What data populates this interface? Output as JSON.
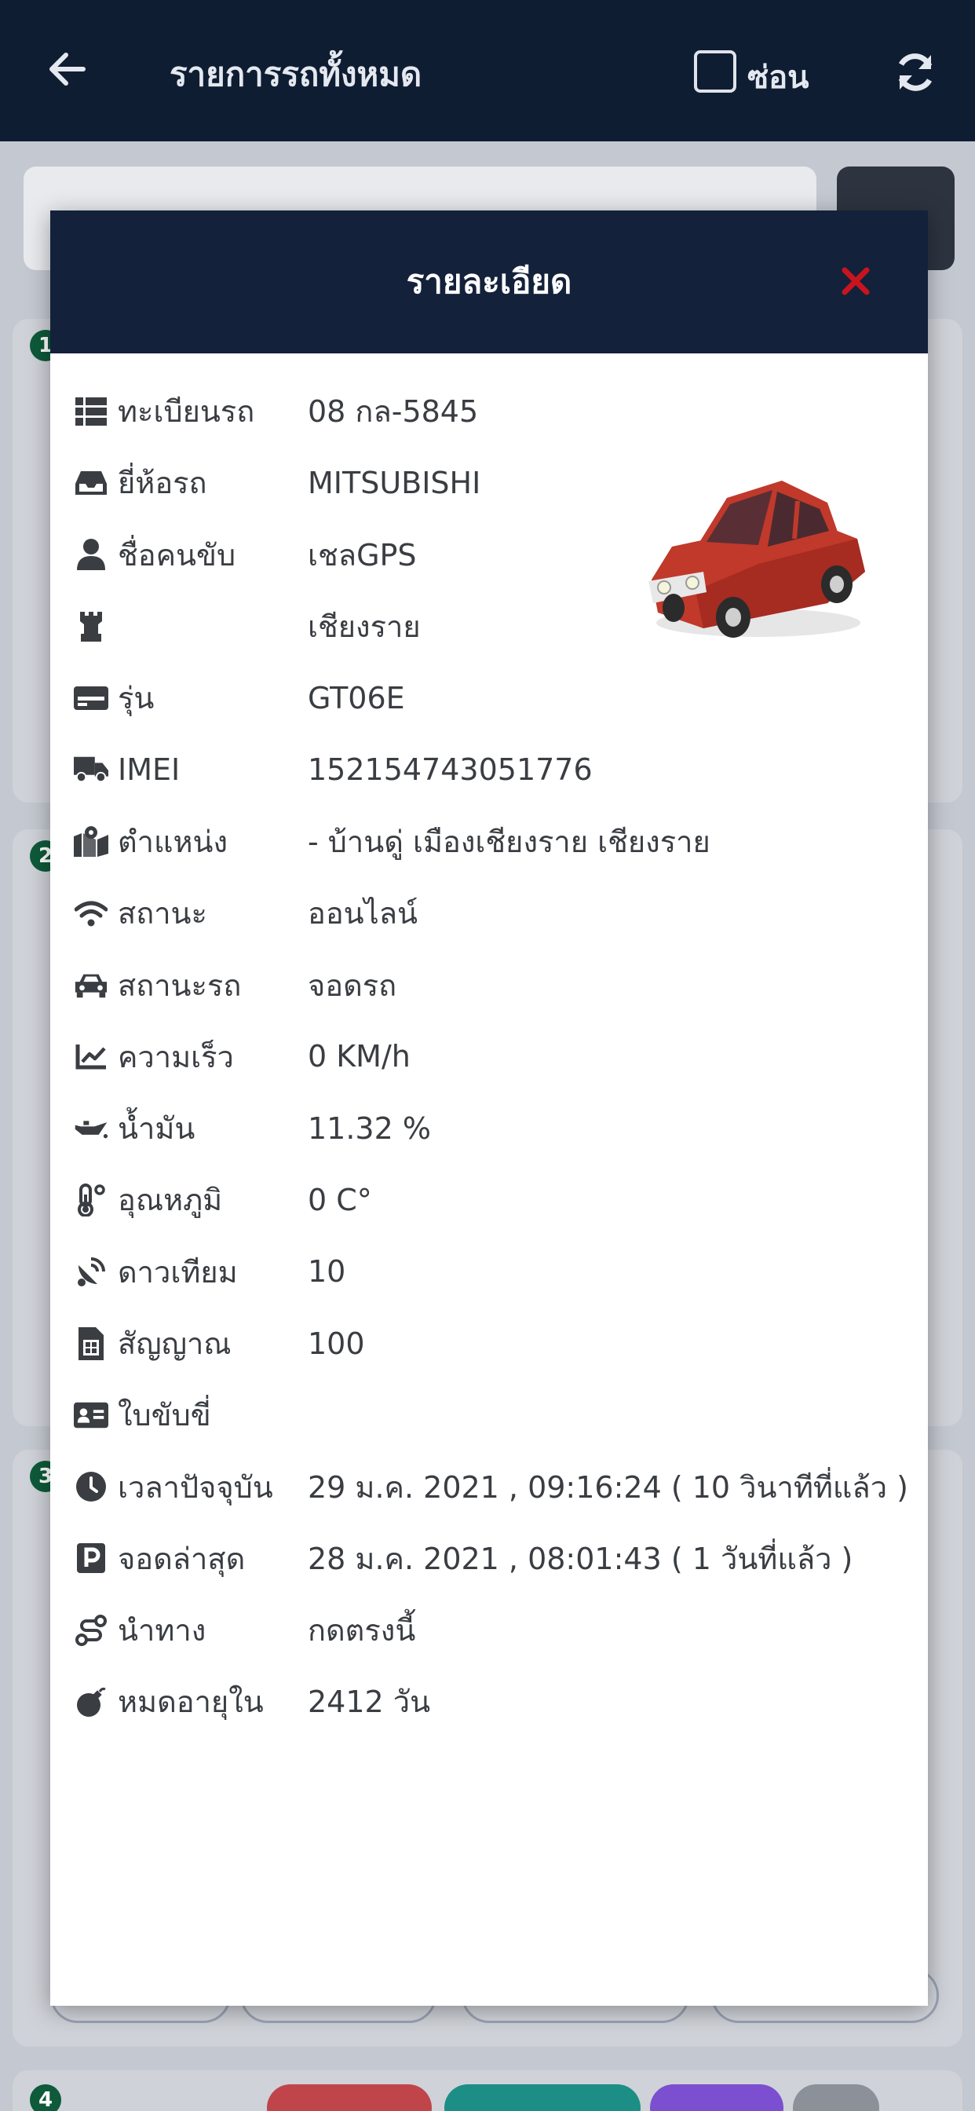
{
  "app": {
    "title": "รายการรถทั้งหมด",
    "hide_label": "ซ่อน"
  },
  "modal": {
    "title": "รายละเอียด",
    "close_color": "#c8141e",
    "rows": [
      {
        "icon": "list-icon",
        "label": "ทะเบียนรถ",
        "value": "08 กล-5845"
      },
      {
        "icon": "inbox-icon",
        "label": "ยี่ห้อรถ",
        "value": "MITSUBISHI"
      },
      {
        "icon": "user-icon",
        "label": "ชื่อคนขับ",
        "value": "เชลGPS"
      },
      {
        "icon": "rook-icon",
        "label": "",
        "value": "เชียงราย"
      },
      {
        "icon": "card-icon",
        "label": "รุ่น",
        "value": "GT06E"
      },
      {
        "icon": "truck-icon",
        "label": "IMEI",
        "value": "152154743051776"
      },
      {
        "icon": "map-marked-icon",
        "label": "ตำแหน่ง",
        "value": "- บ้านดู่ เมืองเชียงราย เชียงราย"
      },
      {
        "icon": "wifi-icon",
        "label": "สถานะ",
        "value": "ออนไลน์"
      },
      {
        "icon": "car-icon",
        "label": "สถานะรถ",
        "value": "จอดรถ"
      },
      {
        "icon": "line-chart-icon",
        "label": "ความเร็ว",
        "value": "0 KM/h"
      },
      {
        "icon": "oil-can-icon",
        "label": "น้ำมัน",
        "value": "11.32 %"
      },
      {
        "icon": "thermometer-icon",
        "label": "อุณหภูมิ",
        "value": "0 C°"
      },
      {
        "icon": "satellite-dish-icon",
        "label": "ดาวเทียม",
        "value": "10"
      },
      {
        "icon": "sim-card-icon",
        "label": "สัญญาณ",
        "value": "100"
      },
      {
        "icon": "id-card-icon",
        "label": "ใบขับขี่",
        "value": ""
      },
      {
        "icon": "clock-icon",
        "label": "เวลาปัจจุบัน",
        "value": "29 ม.ค. 2021 , 09:16:24 ( 10 วินาทีที่แล้ว )"
      },
      {
        "icon": "parking-icon",
        "label": "จอดล่าสุด",
        "value": "28 ม.ค. 2021 , 08:01:43 ( 1 วันที่แล้ว )"
      },
      {
        "icon": "route-icon",
        "label": "นำทาง",
        "value": "กดตรงนี้"
      },
      {
        "icon": "bomb-icon",
        "label": "หมดอายุใน",
        "value": "2412 วัน"
      }
    ]
  },
  "background": {
    "card_numbers": [
      "1",
      "2",
      "3",
      "4"
    ]
  }
}
